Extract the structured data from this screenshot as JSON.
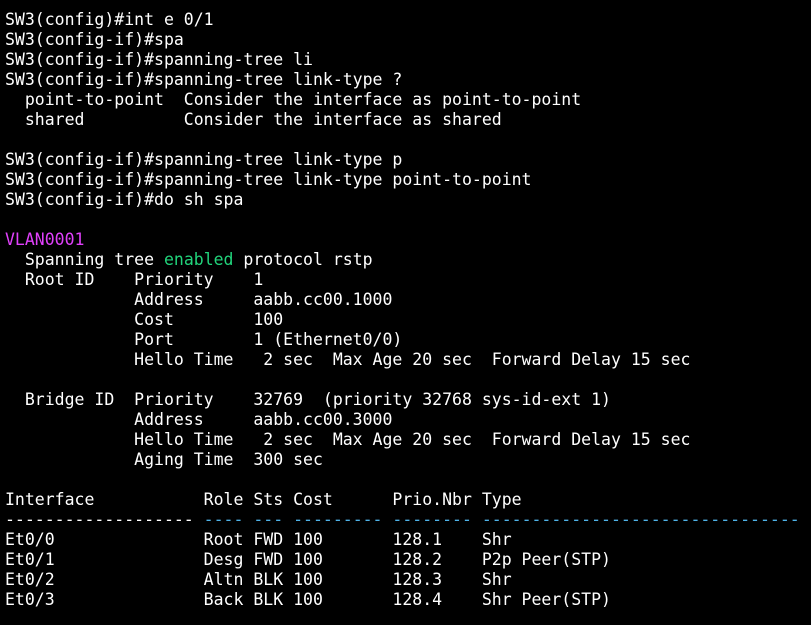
{
  "terminal": {
    "colors": {
      "background": "#000000",
      "text": "#ffffff",
      "vlan_highlight": "#e040fb",
      "keyword_enabled": "#21d47b",
      "separator_blue": "#4fb3e8"
    },
    "commands": [
      "SW3(config)#int e 0/1",
      "SW3(config-if)#spa",
      "SW3(config-if)#spanning-tree li",
      "SW3(config-if)#spanning-tree link-type ?"
    ],
    "help": [
      "  point-to-point  Consider the interface as point-to-point",
      "  shared          Consider the interface as shared"
    ],
    "commands2": [
      "SW3(config-if)#spanning-tree link-type p",
      "SW3(config-if)#spanning-tree link-type point-to-point",
      "SW3(config-if)#do sh spa"
    ],
    "vlan": "VLAN0001",
    "spanning_prefix": "  Spanning tree ",
    "spanning_enabled": "enabled",
    "spanning_suffix": " protocol rstp",
    "root": [
      "  Root ID    Priority    1",
      "             Address     aabb.cc00.1000",
      "             Cost        100",
      "             Port        1 (Ethernet0/0)",
      "             Hello Time   2 sec  Max Age 20 sec  Forward Delay 15 sec"
    ],
    "bridge": [
      "  Bridge ID  Priority    32769  (priority 32768 sys-id-ext 1)",
      "             Address     aabb.cc00.3000",
      "             Hello Time   2 sec  Max Age 20 sec  Forward Delay 15 sec",
      "             Aging Time  300 sec"
    ],
    "table_header": "Interface           Role Sts Cost      Prio.Nbr Type",
    "separator_first": "-------------------",
    "separator_rest": " ---- --- --------- -------- --------------------------------",
    "rows": [
      "Et0/0               Root FWD 100       128.1    Shr",
      "Et0/1               Desg FWD 100       128.2    P2p Peer(STP)",
      "Et0/2               Altn BLK 100       128.3    Shr",
      "Et0/3               Back BLK 100       128.4    Shr Peer(STP)"
    ]
  }
}
